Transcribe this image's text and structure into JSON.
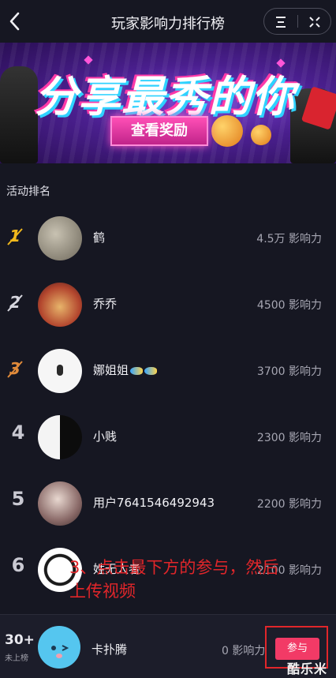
{
  "header": {
    "title": "玩家影响力排行榜",
    "back_icon": "chevron-left-icon",
    "menu_icon": "menu-icon",
    "close_icon": "close-icon"
  },
  "banner": {
    "headline": "分享最秀的你",
    "button_label": "查看奖励"
  },
  "section_title": "活动排名",
  "rankings": [
    {
      "rank": "1",
      "name": "鹤",
      "score": "4.5万 影响力"
    },
    {
      "rank": "2",
      "name": "乔乔",
      "score": "4500 影响力"
    },
    {
      "rank": "3",
      "name": "娜姐姐",
      "score": "3700 影响力"
    },
    {
      "rank": "4",
      "name": "小贱",
      "score": "2300 影响力"
    },
    {
      "rank": "5",
      "name": "用户7641546492943",
      "score": "2200 影响力"
    },
    {
      "rank": "6",
      "name": "姓无人者",
      "score": "2100 影响力"
    }
  ],
  "annotation": {
    "line1": "3、点击最下方的参与，然后",
    "line2": "上传视频"
  },
  "my_entry": {
    "rank": "30+",
    "rank_note": "未上榜",
    "name": "卡扑腾",
    "score": "0 影响力",
    "join_label": "参与"
  },
  "watermark": "酷乐米",
  "colors": {
    "background": "#161722",
    "accent_pink": "#f23a66",
    "annotation_red": "#e1262a",
    "gold": "#f0b81c",
    "silver": "#d6d6de",
    "bronze": "#e08a3a"
  }
}
